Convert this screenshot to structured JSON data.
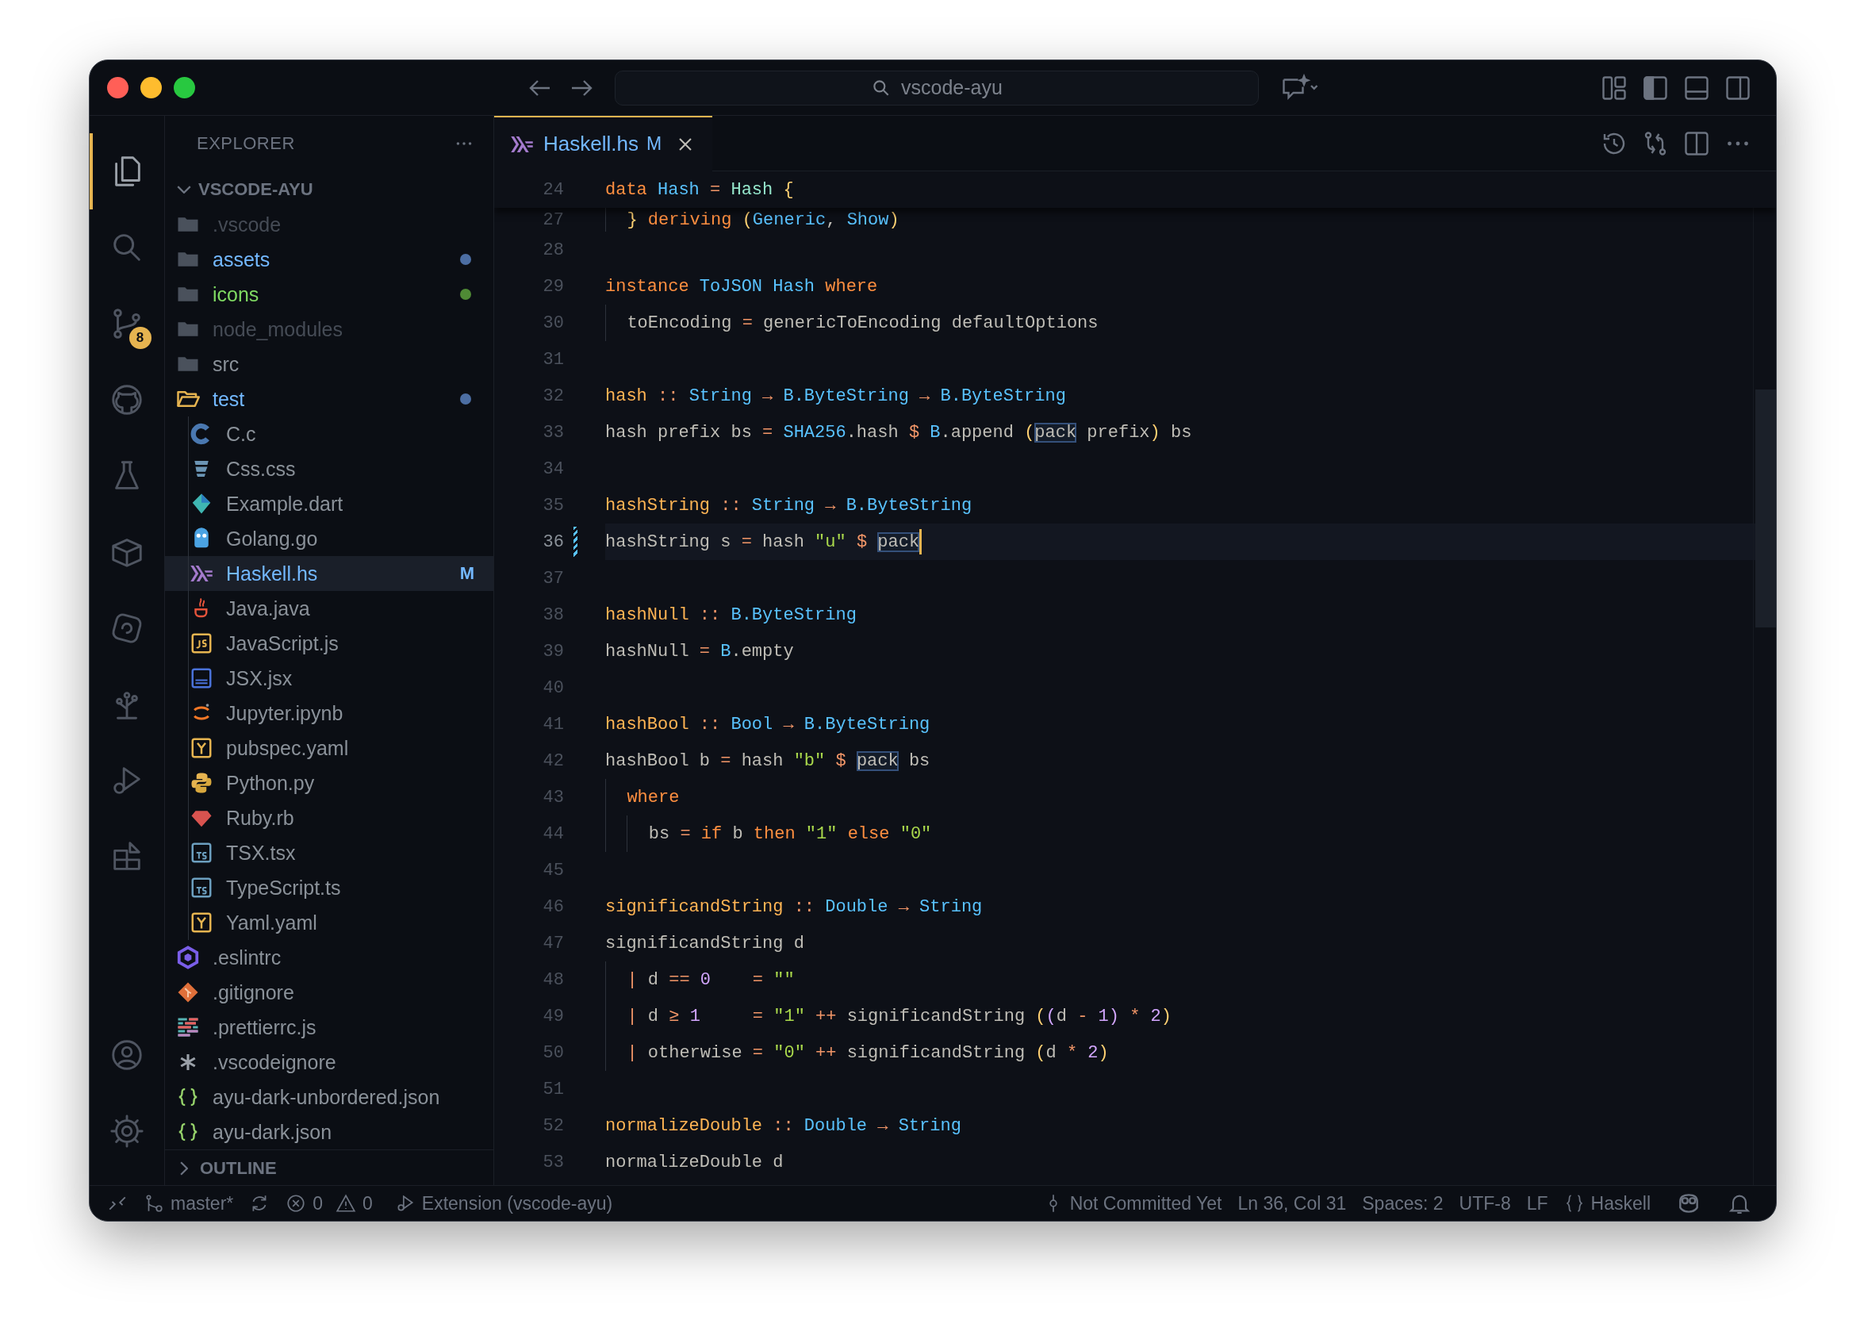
{
  "title_bar": {
    "command_center": "vscode-ayu"
  },
  "activity_bar": {
    "items": [
      {
        "kind": "files",
        "selected": true
      },
      {
        "kind": "search",
        "selected": false
      },
      {
        "kind": "source-control",
        "selected": false,
        "badge": "8"
      },
      {
        "kind": "github",
        "selected": false
      },
      {
        "kind": "testing",
        "selected": false
      },
      {
        "kind": "containers",
        "selected": false
      },
      {
        "kind": "swirl",
        "selected": false
      },
      {
        "kind": "tree",
        "selected": false
      },
      {
        "kind": "debug",
        "selected": false
      },
      {
        "kind": "extensions",
        "selected": false
      }
    ],
    "bottom_items": [
      {
        "kind": "account",
        "selected": false
      },
      {
        "kind": "settings",
        "selected": false
      }
    ]
  },
  "explorer": {
    "title": "EXPLORER",
    "root": {
      "label": "VSCODE-AYU",
      "expanded": true,
      "children": [
        {
          "label": ".vscode",
          "kind": "folder",
          "modified": false,
          "untracked": false,
          "ignored": true,
          "expanded": false,
          "selected": false
        },
        {
          "label": "assets",
          "kind": "folder",
          "modified": true,
          "untracked": false,
          "ignored": false,
          "expanded": false,
          "selected": false
        },
        {
          "label": "icons",
          "kind": "folder",
          "modified": false,
          "untracked": true,
          "ignored": false,
          "expanded": false,
          "selected": false
        },
        {
          "label": "node_modules",
          "kind": "folder",
          "modified": false,
          "untracked": false,
          "ignored": true,
          "expanded": false,
          "selected": false
        },
        {
          "label": "src",
          "kind": "folder",
          "modified": false,
          "untracked": false,
          "ignored": false,
          "expanded": false,
          "selected": false
        },
        {
          "label": "test",
          "kind": "folder",
          "modified": true,
          "untracked": false,
          "ignored": false,
          "expanded": true,
          "selected": false,
          "children": [
            {
              "label": "C.c",
              "kind": "c",
              "modified": false,
              "untracked": false,
              "ignored": false,
              "selected": false
            },
            {
              "label": "Css.css",
              "kind": "css",
              "modified": false,
              "untracked": false,
              "ignored": false,
              "selected": false
            },
            {
              "label": "Example.dart",
              "kind": "dart",
              "modified": false,
              "untracked": false,
              "ignored": false,
              "selected": false
            },
            {
              "label": "Golang.go",
              "kind": "go",
              "modified": false,
              "untracked": false,
              "ignored": false,
              "selected": false
            },
            {
              "label": "Haskell.hs",
              "kind": "haskell",
              "modified": true,
              "untracked": false,
              "ignored": false,
              "selected": true,
              "badge": "M"
            },
            {
              "label": "Java.java",
              "kind": "java",
              "modified": false,
              "untracked": false,
              "ignored": false,
              "selected": false
            },
            {
              "label": "JavaScript.js",
              "kind": "js",
              "modified": false,
              "untracked": false,
              "ignored": false,
              "selected": false
            },
            {
              "label": "JSX.jsx",
              "kind": "jsx",
              "modified": false,
              "untracked": false,
              "ignored": false,
              "selected": false
            },
            {
              "label": "Jupyter.ipynb",
              "kind": "jupyter",
              "modified": false,
              "untracked": false,
              "ignored": false,
              "selected": false
            },
            {
              "label": "pubspec.yaml",
              "kind": "yaml",
              "modified": false,
              "untracked": false,
              "ignored": false,
              "selected": false
            },
            {
              "label": "Python.py",
              "kind": "python",
              "modified": false,
              "untracked": false,
              "ignored": false,
              "selected": false
            },
            {
              "label": "Ruby.rb",
              "kind": "ruby",
              "modified": false,
              "untracked": false,
              "ignored": false,
              "selected": false
            },
            {
              "label": "TSX.tsx",
              "kind": "ts",
              "modified": false,
              "untracked": false,
              "ignored": false,
              "selected": false
            },
            {
              "label": "TypeScript.ts",
              "kind": "ts",
              "modified": false,
              "untracked": false,
              "ignored": false,
              "selected": false
            },
            {
              "label": "Yaml.yaml",
              "kind": "yaml",
              "modified": false,
              "untracked": false,
              "ignored": false,
              "selected": false
            }
          ]
        },
        {
          "label": ".eslintrc",
          "kind": "eslint",
          "modified": false,
          "untracked": false,
          "ignored": false,
          "selected": false
        },
        {
          "label": ".gitignore",
          "kind": "git",
          "modified": false,
          "untracked": false,
          "ignored": false,
          "selected": false
        },
        {
          "label": ".prettierrc.js",
          "kind": "prettier",
          "modified": false,
          "untracked": false,
          "ignored": false,
          "selected": false
        },
        {
          "label": ".vscodeignore",
          "kind": "ignore",
          "modified": false,
          "untracked": false,
          "ignored": false,
          "selected": false
        },
        {
          "label": "ayu-dark-unbordered.json",
          "kind": "json",
          "modified": false,
          "untracked": false,
          "ignored": false,
          "selected": false
        },
        {
          "label": "ayu-dark.json",
          "kind": "json",
          "modified": false,
          "untracked": false,
          "ignored": false,
          "selected": false
        }
      ]
    },
    "outline": {
      "label": "OUTLINE",
      "expanded": false
    }
  },
  "tabs": [
    {
      "label": "Haskell.hs",
      "kind": "haskell",
      "badge": "M",
      "selected": true
    }
  ],
  "editor": {
    "sticky_line": {
      "number": "24",
      "tokens": [
        {
          "text": "data ",
          "kind": "keyword"
        },
        {
          "text": "Hash ",
          "kind": "type"
        },
        {
          "text": "= ",
          "kind": "op"
        },
        {
          "text": "Hash ",
          "kind": "ctor"
        },
        {
          "text": "{",
          "kind": "bracket"
        }
      ]
    },
    "peek_line": {
      "number": "27",
      "tokens": [
        {
          "text": "  } ",
          "kind": "bracket"
        },
        {
          "text": "deriving ",
          "kind": "keyword"
        },
        {
          "text": "(",
          "kind": "bracket"
        },
        {
          "text": "Generic",
          "kind": "type"
        },
        {
          "text": ", ",
          "kind": "plain"
        },
        {
          "text": "Show",
          "kind": "type"
        },
        {
          "text": ")",
          "kind": "bracket"
        }
      ]
    },
    "lines": [
      {
        "number": "28",
        "current": false
      },
      {
        "number": "29",
        "current": false,
        "tokens": [
          {
            "text": "instance ",
            "kind": "keyword"
          },
          {
            "text": "ToJSON ",
            "kind": "type"
          },
          {
            "text": "Hash ",
            "kind": "type"
          },
          {
            "text": "where",
            "kind": "keyword"
          }
        ]
      },
      {
        "number": "30",
        "current": false,
        "tokens": [
          {
            "text": "  toEncoding ",
            "kind": "plain"
          },
          {
            "text": "= ",
            "kind": "op"
          },
          {
            "text": "genericToEncoding defaultOptions",
            "kind": "plain"
          }
        ]
      },
      {
        "number": "31",
        "current": false
      },
      {
        "number": "32",
        "current": false,
        "tokens": [
          {
            "text": "hash ",
            "kind": "func"
          },
          {
            "text": ":: ",
            "kind": "op"
          },
          {
            "text": "String ",
            "kind": "type"
          },
          {
            "text": "→ ",
            "kind": "op"
          },
          {
            "text": "B.ByteString ",
            "kind": "type"
          },
          {
            "text": "→ ",
            "kind": "op"
          },
          {
            "text": "B.ByteString",
            "kind": "type"
          }
        ]
      },
      {
        "number": "33",
        "current": false,
        "tokens": [
          {
            "text": "hash prefix bs ",
            "kind": "plain"
          },
          {
            "text": "= ",
            "kind": "op"
          },
          {
            "text": "SHA256",
            "kind": "type"
          },
          {
            "text": ".hash ",
            "kind": "plain"
          },
          {
            "text": "$ ",
            "kind": "op"
          },
          {
            "text": "B",
            "kind": "type"
          },
          {
            "text": ".append ",
            "kind": "plain"
          },
          {
            "text": "(",
            "kind": "bracket"
          },
          {
            "text": "pack",
            "kind": "match"
          },
          {
            "text": " prefix",
            "kind": "plain"
          },
          {
            "text": ")",
            "kind": "bracket"
          },
          {
            "text": " bs",
            "kind": "plain"
          }
        ]
      },
      {
        "number": "34",
        "current": false
      },
      {
        "number": "35",
        "current": false,
        "tokens": [
          {
            "text": "hashString ",
            "kind": "func"
          },
          {
            "text": ":: ",
            "kind": "op"
          },
          {
            "text": "String ",
            "kind": "type"
          },
          {
            "text": "→ ",
            "kind": "op"
          },
          {
            "text": "B.ByteString",
            "kind": "type"
          }
        ]
      },
      {
        "number": "36",
        "current": true,
        "tokens": [
          {
            "text": "hashString s ",
            "kind": "plain"
          },
          {
            "text": "= ",
            "kind": "op"
          },
          {
            "text": "hash ",
            "kind": "plain"
          },
          {
            "text": "\"u\" ",
            "kind": "string"
          },
          {
            "text": "$ ",
            "kind": "op"
          },
          {
            "text": "pack",
            "kind": "match"
          }
        ]
      },
      {
        "number": "37",
        "current": false
      },
      {
        "number": "38",
        "current": false,
        "tokens": [
          {
            "text": "hashNull ",
            "kind": "func"
          },
          {
            "text": ":: ",
            "kind": "op"
          },
          {
            "text": "B.ByteString",
            "kind": "type"
          }
        ]
      },
      {
        "number": "39",
        "current": false,
        "tokens": [
          {
            "text": "hashNull ",
            "kind": "plain"
          },
          {
            "text": "= ",
            "kind": "op"
          },
          {
            "text": "B",
            "kind": "type"
          },
          {
            "text": ".empty",
            "kind": "plain"
          }
        ]
      },
      {
        "number": "40",
        "current": false
      },
      {
        "number": "41",
        "current": false,
        "tokens": [
          {
            "text": "hashBool ",
            "kind": "func"
          },
          {
            "text": ":: ",
            "kind": "op"
          },
          {
            "text": "Bool ",
            "kind": "type"
          },
          {
            "text": "→ ",
            "kind": "op"
          },
          {
            "text": "B.ByteString",
            "kind": "type"
          }
        ]
      },
      {
        "number": "42",
        "current": false,
        "tokens": [
          {
            "text": "hashBool b ",
            "kind": "plain"
          },
          {
            "text": "= ",
            "kind": "op"
          },
          {
            "text": "hash ",
            "kind": "plain"
          },
          {
            "text": "\"b\" ",
            "kind": "string"
          },
          {
            "text": "$ ",
            "kind": "op"
          },
          {
            "text": "pack",
            "kind": "match"
          },
          {
            "text": " bs",
            "kind": "plain"
          }
        ]
      },
      {
        "number": "43",
        "current": false,
        "tokens": [
          {
            "text": "  where",
            "kind": "keyword"
          }
        ]
      },
      {
        "number": "44",
        "current": false,
        "tokens": [
          {
            "text": "    bs ",
            "kind": "plain"
          },
          {
            "text": "= ",
            "kind": "op"
          },
          {
            "text": "if ",
            "kind": "keyword"
          },
          {
            "text": "b ",
            "kind": "plain"
          },
          {
            "text": "then ",
            "kind": "keyword"
          },
          {
            "text": "\"1\" ",
            "kind": "string"
          },
          {
            "text": "else ",
            "kind": "keyword"
          },
          {
            "text": "\"0\"",
            "kind": "string"
          }
        ]
      },
      {
        "number": "45",
        "current": false
      },
      {
        "number": "46",
        "current": false,
        "tokens": [
          {
            "text": "significandString ",
            "kind": "func"
          },
          {
            "text": ":: ",
            "kind": "op"
          },
          {
            "text": "Double ",
            "kind": "type"
          },
          {
            "text": "→ ",
            "kind": "op"
          },
          {
            "text": "String",
            "kind": "type"
          }
        ]
      },
      {
        "number": "47",
        "current": false,
        "tokens": [
          {
            "text": "significandString d",
            "kind": "plain"
          }
        ]
      },
      {
        "number": "48",
        "current": false,
        "tokens": [
          {
            "text": "  | ",
            "kind": "op"
          },
          {
            "text": "d ",
            "kind": "plain"
          },
          {
            "text": "== ",
            "kind": "op"
          },
          {
            "text": "0",
            "kind": "number"
          },
          {
            "text": "    = ",
            "kind": "op"
          },
          {
            "text": "\"\"",
            "kind": "string"
          }
        ]
      },
      {
        "number": "49",
        "current": false,
        "tokens": [
          {
            "text": "  | ",
            "kind": "op"
          },
          {
            "text": "d ",
            "kind": "plain"
          },
          {
            "text": "≥ ",
            "kind": "op"
          },
          {
            "text": "1",
            "kind": "number"
          },
          {
            "text": "     = ",
            "kind": "op"
          },
          {
            "text": "\"1\" ",
            "kind": "string"
          },
          {
            "text": "++ ",
            "kind": "op"
          },
          {
            "text": "significandString ",
            "kind": "plain"
          },
          {
            "text": "(",
            "kind": "bracket"
          },
          {
            "text": "(",
            "kind": "bracket2"
          },
          {
            "text": "d ",
            "kind": "plain"
          },
          {
            "text": "- ",
            "kind": "op"
          },
          {
            "text": "1",
            "kind": "number"
          },
          {
            "text": ")",
            "kind": "bracket2"
          },
          {
            "text": " * ",
            "kind": "op"
          },
          {
            "text": "2",
            "kind": "number"
          },
          {
            "text": ")",
            "kind": "bracket"
          }
        ]
      },
      {
        "number": "50",
        "current": false,
        "tokens": [
          {
            "text": "  | ",
            "kind": "op"
          },
          {
            "text": "otherwise ",
            "kind": "plain"
          },
          {
            "text": "= ",
            "kind": "op"
          },
          {
            "text": "\"0\" ",
            "kind": "string"
          },
          {
            "text": "++ ",
            "kind": "op"
          },
          {
            "text": "significandString ",
            "kind": "plain"
          },
          {
            "text": "(",
            "kind": "bracket"
          },
          {
            "text": "d ",
            "kind": "plain"
          },
          {
            "text": "* ",
            "kind": "op"
          },
          {
            "text": "2",
            "kind": "number"
          },
          {
            "text": ")",
            "kind": "bracket"
          }
        ]
      },
      {
        "number": "51",
        "current": false
      },
      {
        "number": "52",
        "current": false,
        "tokens": [
          {
            "text": "normalizeDouble ",
            "kind": "func"
          },
          {
            "text": ":: ",
            "kind": "op"
          },
          {
            "text": "Double ",
            "kind": "type"
          },
          {
            "text": "→ ",
            "kind": "op"
          },
          {
            "text": "String",
            "kind": "type"
          }
        ]
      },
      {
        "number": "53",
        "current": false,
        "tokens": [
          {
            "text": "normalizeDouble d",
            "kind": "plain"
          }
        ]
      }
    ]
  },
  "status_bar": {
    "branch": "master*",
    "errors": "0",
    "warnings": "0",
    "launch": "Extension (vscode-ayu)",
    "blame": "Not Committed Yet",
    "cursor": "Ln 36, Col 31",
    "indentation": "Spaces: 2",
    "encoding": "UTF-8",
    "eol": "LF",
    "language": "Haskell"
  }
}
